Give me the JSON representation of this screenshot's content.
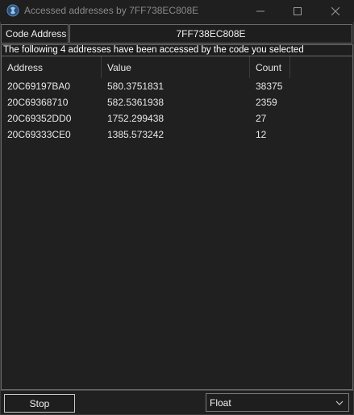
{
  "window": {
    "title": "Accessed addresses by 7FF738EC808E",
    "icon": "cheat-engine-icon"
  },
  "code_address": {
    "label": "Code Address",
    "value": "7FF738EC808E"
  },
  "info_text": "The following 4 addresses have been accessed by the code you selected",
  "table": {
    "columns": [
      "Address",
      "Value",
      "Count"
    ],
    "rows": [
      {
        "address": "20C69197BA0",
        "value": "580.3751831",
        "count": "38375"
      },
      {
        "address": "20C69368710",
        "value": "582.5361938",
        "count": "2359"
      },
      {
        "address": "20C69352DD0",
        "value": "1752.299438",
        "count": "27"
      },
      {
        "address": "20C69333CE0",
        "value": "1385.573242",
        "count": "12"
      }
    ]
  },
  "controls": {
    "stop_label": "Stop",
    "value_type": "Float"
  }
}
